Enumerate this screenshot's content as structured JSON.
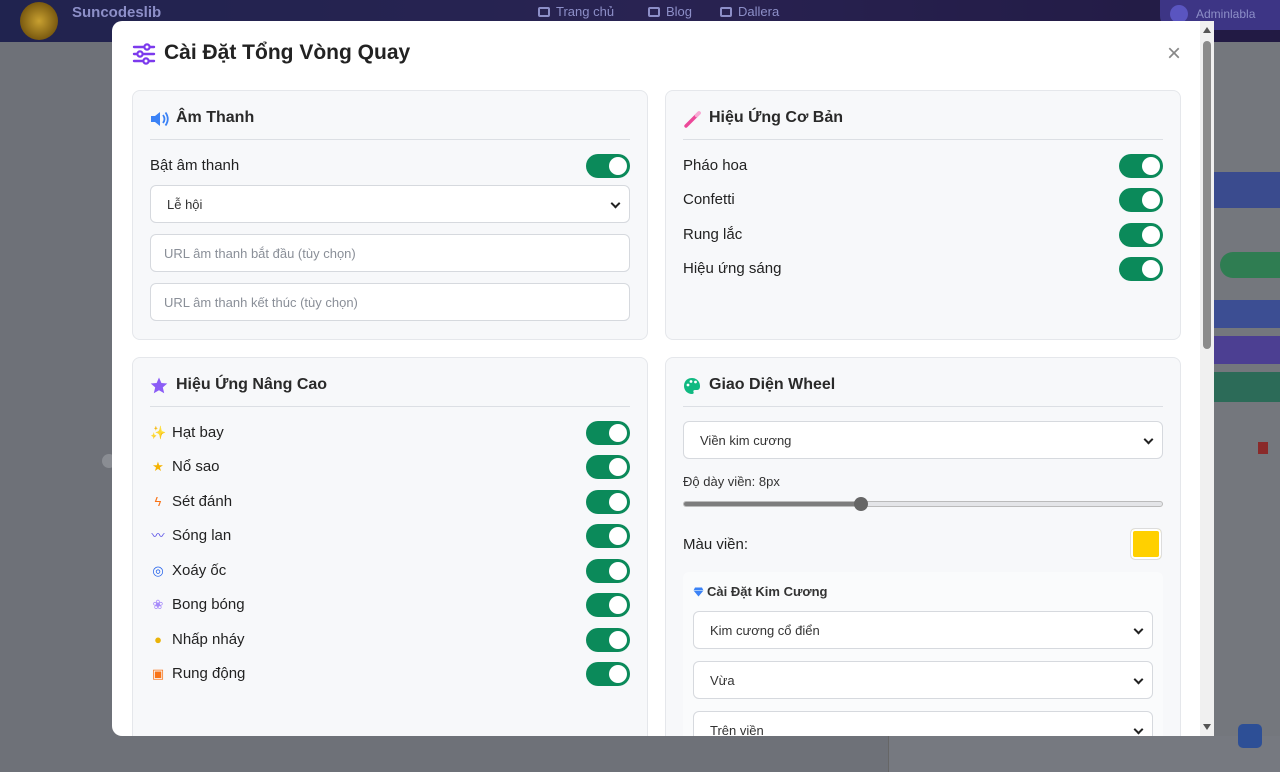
{
  "background": {
    "brand": "Suncodeslib",
    "nav": [
      "Trang chủ",
      "Blog",
      "Dallera"
    ],
    "user": "Adminlabla"
  },
  "modal": {
    "title": "Cài Đặt Tổng Vòng Quay",
    "close": "×"
  },
  "sound": {
    "title": "Âm Thanh",
    "enable_label": "Bật âm thanh",
    "enable_on": true,
    "theme_selected": "Lễ hội",
    "start_url_placeholder": "URL âm thanh bắt đầu (tùy chọn)",
    "end_url_placeholder": "URL âm thanh kết thúc (tùy chọn)"
  },
  "basic_effects": {
    "title": "Hiệu Ứng Cơ Bản",
    "items": [
      {
        "label": "Pháo hoa",
        "on": true
      },
      {
        "label": "Confetti",
        "on": true
      },
      {
        "label": "Rung lắc",
        "on": true
      },
      {
        "label": "Hiệu ứng sáng",
        "on": true
      }
    ]
  },
  "advanced_effects": {
    "title": "Hiệu Ứng Nâng Cao",
    "items": [
      {
        "label": "Hạt bay",
        "icon": "sparkles-icon",
        "on": true
      },
      {
        "label": "Nổ sao",
        "icon": "star-icon",
        "on": true
      },
      {
        "label": "Sét đánh",
        "icon": "lightning-icon",
        "on": true
      },
      {
        "label": "Sóng lan",
        "icon": "wave-icon",
        "on": true
      },
      {
        "label": "Xoáy ốc",
        "icon": "spiral-icon",
        "on": true
      },
      {
        "label": "Bong bóng",
        "icon": "bubbles-icon",
        "on": true
      },
      {
        "label": "Nhấp nháy",
        "icon": "bulb-icon",
        "on": true
      },
      {
        "label": "Rung động",
        "icon": "vibration-icon",
        "on": true
      }
    ]
  },
  "wheel_theme": {
    "title": "Giao Diện Wheel",
    "border_style_selected": "Viền kim cương",
    "thickness_label": "Độ dày viền: 8px",
    "thickness_value": 8,
    "thickness_fraction": 0.37,
    "border_color_label": "Màu viền:",
    "border_color": "#FFD000",
    "diamond": {
      "title": "Cài Đặt Kim Cương",
      "style_selected": "Kim cương cổ điển",
      "size_selected": "Vừa",
      "position_selected": "Trên viền"
    }
  },
  "colors": {
    "accent_toggle": "#0b8a5a",
    "title_icon": "#7c3aed"
  }
}
